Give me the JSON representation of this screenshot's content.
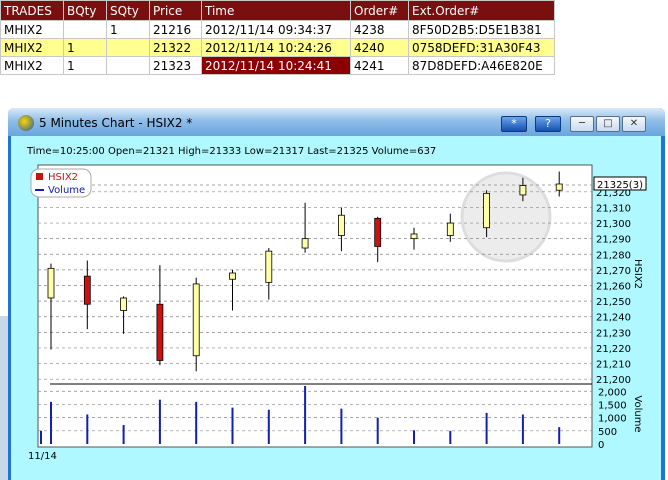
{
  "trades": {
    "headers": [
      "TRADES",
      "BQty",
      "SQty",
      "Price",
      "Time",
      "Order#",
      "Ext.Order#"
    ],
    "rows": [
      {
        "symbol": "MHIX2",
        "bqty": "",
        "sqty": "1",
        "price": "21216",
        "time": "2012/11/14 09:34:37",
        "order": "4238",
        "ext": "8F50D2B5:D5E1B381"
      },
      {
        "symbol": "MHIX2",
        "bqty": "1",
        "sqty": "",
        "price": "21322",
        "time": "2012/11/14 10:24:26",
        "order": "4240",
        "ext": "0758DEFD:31A30F43"
      },
      {
        "symbol": "MHIX2",
        "bqty": "1",
        "sqty": "",
        "price": "21323",
        "time": "2012/11/14 10:24:41",
        "order": "4241",
        "ext": "87D8DEFD:A46E820E"
      }
    ]
  },
  "window": {
    "title": "5 Minutes Chart - HSIX2 *",
    "star_button": "*",
    "help_button": "?"
  },
  "chart_info": "Time=10:25:00 Open=21321 High=21333 Low=21317 Last=21325 Volume=637",
  "date_label": "11/14",
  "colors": {
    "up": "#ffffa8",
    "down": "#cc1111",
    "volume": "#1020b0",
    "header": "#7a0f0f",
    "highlight": "#ffff90",
    "selected": "#8b0000",
    "client": "#aff8ff"
  },
  "chart_data": {
    "type": "candlestick",
    "legend": [
      {
        "name": "HSIX2",
        "color": "#cc1111"
      },
      {
        "name": "Volume",
        "color": "#1020b0"
      }
    ],
    "price_axis_label": "HSIX2",
    "volume_axis_label": "Volume",
    "price_ticks": [
      21200,
      21210,
      21220,
      21230,
      21240,
      21250,
      21260,
      21270,
      21280,
      21290,
      21300,
      21310,
      21320
    ],
    "price_tick_labels": [
      "21,200",
      "21,210",
      "21,220",
      "21,230",
      "21,240",
      "21,250",
      "21,260",
      "21,270",
      "21,280",
      "21,290",
      "21,300",
      "21,310",
      "21,320"
    ],
    "ylim": [
      21190,
      21330
    ],
    "last_label": "21325(3)",
    "last_price": 21325,
    "volume_ticks": [
      0,
      500,
      1000,
      1500,
      2000
    ],
    "volume_tick_labels": [
      "0",
      "500",
      "1,000",
      "1,500",
      "2,000"
    ],
    "volume_lim": [
      0,
      2200
    ],
    "candles": [
      {
        "open": 21252,
        "high": 21274,
        "low": 21219,
        "close": 21271,
        "volume": 1600
      },
      {
        "open": 21266,
        "high": 21276,
        "low": 21232,
        "close": 21248,
        "volume": 1120
      },
      {
        "open": 21244,
        "high": 21253,
        "low": 21229,
        "close": 21252,
        "volume": 720
      },
      {
        "open": 21248,
        "high": 21273,
        "low": 21209,
        "close": 21212,
        "volume": 1680
      },
      {
        "open": 21215,
        "high": 21265,
        "low": 21205,
        "close": 21261,
        "volume": 1600
      },
      {
        "open": 21264,
        "high": 21270,
        "low": 21244,
        "close": 21268,
        "volume": 1380
      },
      {
        "open": 21262,
        "high": 21284,
        "low": 21251,
        "close": 21282,
        "volume": 1300
      },
      {
        "open": 21284,
        "high": 21313,
        "low": 21281,
        "close": 21290,
        "volume": 2200
      },
      {
        "open": 21292,
        "high": 21310,
        "low": 21282,
        "close": 21305,
        "volume": 1340
      },
      {
        "open": 21303,
        "high": 21304,
        "low": 21275,
        "close": 21285,
        "volume": 1000
      },
      {
        "open": 21290,
        "high": 21297,
        "low": 21283,
        "close": 21293,
        "volume": 520
      },
      {
        "open": 21292,
        "high": 21306,
        "low": 21288,
        "close": 21300,
        "volume": 500
      },
      {
        "open": 21297,
        "high": 21321,
        "low": 21291,
        "close": 21319,
        "volume": 1180
      },
      {
        "open": 21318,
        "high": 21329,
        "low": 21314,
        "close": 21324,
        "volume": 1120
      },
      {
        "open": 21321,
        "high": 21333,
        "low": 21317,
        "close": 21325,
        "volume": 637
      }
    ]
  }
}
